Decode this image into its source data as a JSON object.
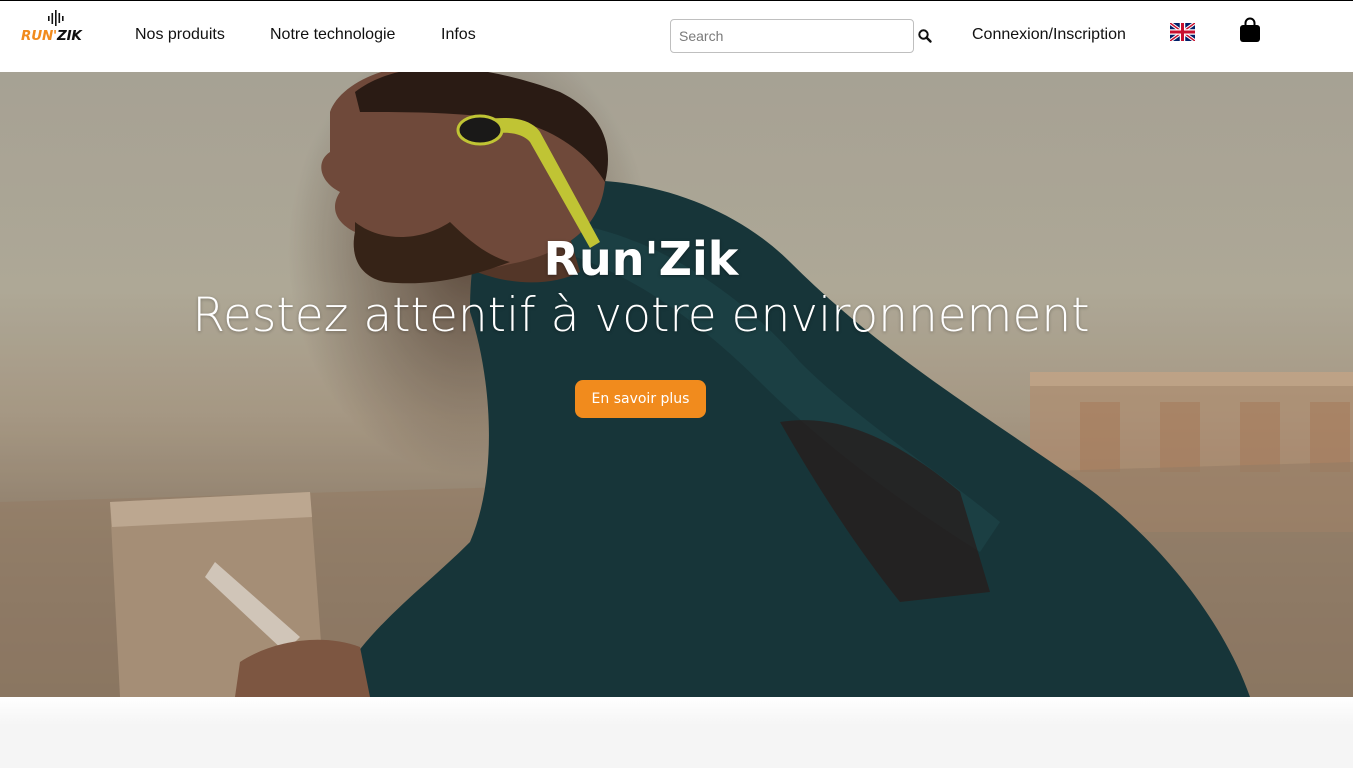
{
  "brand": {
    "logo_run": "RUN'",
    "logo_zik": "ZIK",
    "accent_color": "#f18b1d"
  },
  "nav": {
    "links": [
      {
        "label": "Nos produits"
      },
      {
        "label": "Notre technologie"
      },
      {
        "label": "Infos"
      }
    ],
    "search": {
      "placeholder": "Search",
      "value": "",
      "icon": "search-icon"
    },
    "login_label": "Connexion/Inscription",
    "language_icon": "uk-flag-icon",
    "cart_icon": "shopping-bag-icon"
  },
  "hero": {
    "title": "Run'Zik",
    "subtitle": "Restez attentif à votre environnement",
    "cta_label": "En savoir plus",
    "cta_color": "#f18b1d",
    "image": "runner-with-bone-conduction-headphones"
  }
}
